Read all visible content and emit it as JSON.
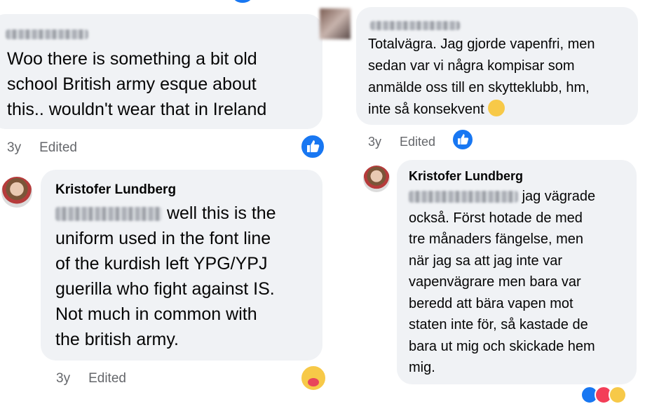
{
  "left": {
    "comment1": {
      "author_blurred": "",
      "lines": [
        "Woo there is something a bit old",
        "school British army esque about",
        "this.. wouldn't wear that in Ireland"
      ],
      "age": "3y",
      "edited": "Edited",
      "reaction_icon": "like-icon"
    },
    "comment2": {
      "author": "Kristofer Lundberg",
      "first_line_text": "well this is the",
      "lines": [
        "uniform used in the font line",
        "of the kurdish left YPG/YPJ",
        "guerilla who fight against IS.",
        "Not much in common with",
        "the british army."
      ],
      "age": "3y",
      "edited": "Edited",
      "reaction_icon": "care-reaction-icon"
    }
  },
  "right": {
    "comment1": {
      "lines": [
        "Totalvägra. Jag gjorde vapenfri, men",
        "sedan var vi några kompisar som",
        "anmälde oss till en skytteklubb, hm,",
        "inte så konsekvent"
      ],
      "age": "3y",
      "edited": "Edited",
      "reaction_icon": "like-icon"
    },
    "comment2": {
      "author": "Kristofer Lundberg",
      "first_line_text": "jag vägrade",
      "lines": [
        "också. Först hotade de med",
        "tre månaders fängelse, men",
        "när jag sa att jag inte var",
        "vapenvägrare men bara var",
        "beredd att bära vapen mot",
        "staten inte för, så kastade de",
        "bara ut mig och skickade hem",
        "mig."
      ],
      "reaction_icon": "reactions-cluster-icon"
    }
  },
  "colors": {
    "bubble": "#f0f2f5",
    "meta_text": "#65676b",
    "like_blue": "#1877f2"
  }
}
